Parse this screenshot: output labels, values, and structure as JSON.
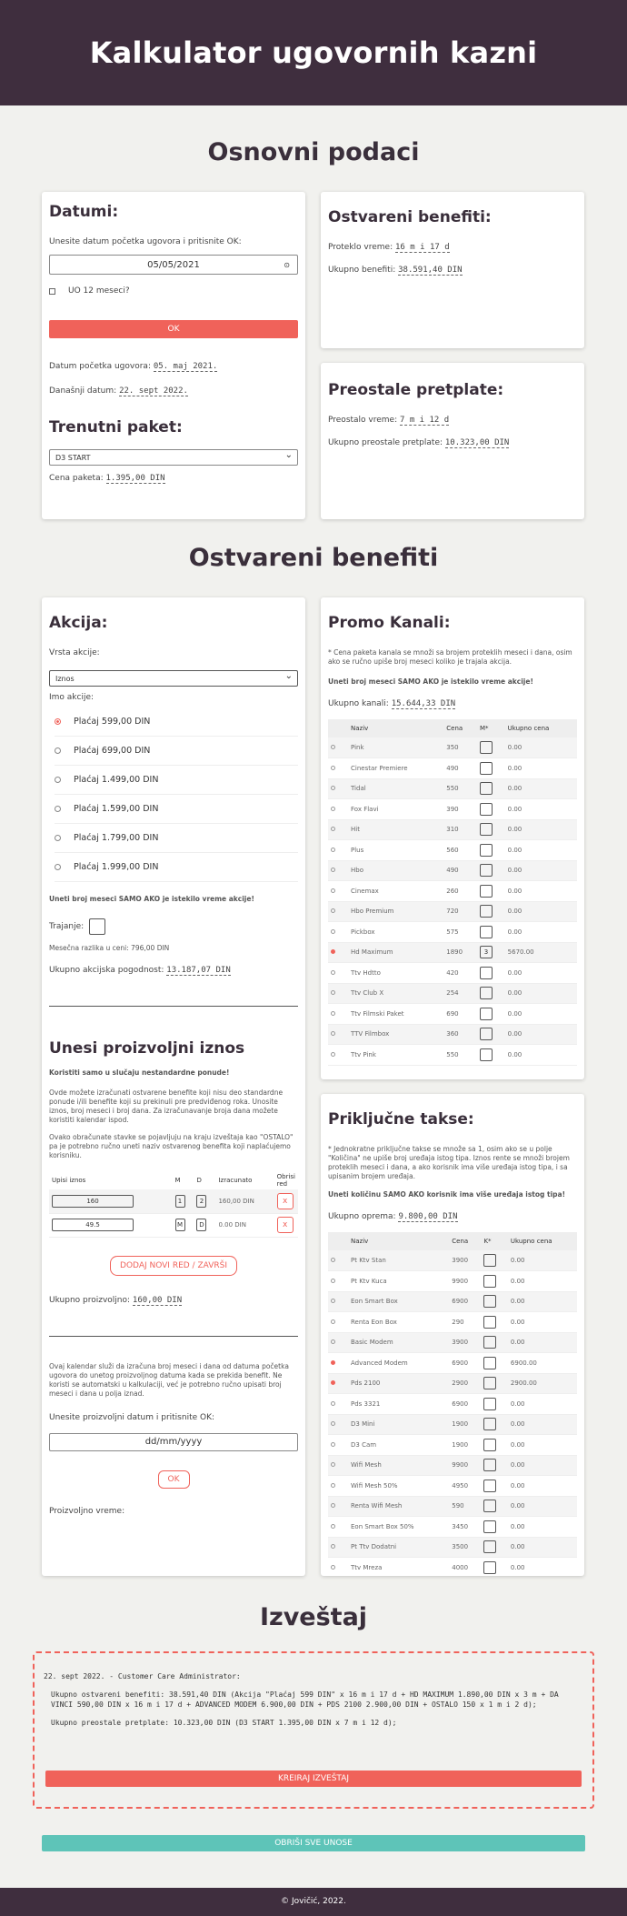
{
  "header": {
    "title": "Kalkulator ugovornih kazni"
  },
  "sections": {
    "basic": "Osnovni podaci",
    "benefits": "Ostvareni benefiti",
    "report": "Izveštaj"
  },
  "dates": {
    "title": "Datumi:",
    "prompt": "Unesite datum početka ugovora i pritisnite OK:",
    "date_value": "05/05/2021",
    "checkbox_label": "UO 12 meseci?",
    "ok": "OK",
    "start_label": "Datum početka ugovora:",
    "start_value": "05. maj 2021.",
    "today_label": "Današnji datum:",
    "today_value": "22. sept 2022."
  },
  "package": {
    "title": "Trenutni paket:",
    "selected": "D3 START",
    "price_label": "Cena paketa:",
    "price_value": "1.395,00 DIN"
  },
  "achieved": {
    "title": "Ostvareni benefiti:",
    "time_label": "Proteklo vreme:",
    "time_value": "16 m i 17 d",
    "total_label": "Ukupno benefiti:",
    "total_value": "38.591,40 DIN"
  },
  "remaining": {
    "title": "Preostale pretplate:",
    "time_label": "Preostalo vreme:",
    "time_value": "7 m i 12 d",
    "total_label": "Ukupno preostale pretplate:",
    "total_value": "10.323,00 DIN"
  },
  "action": {
    "title": "Akcija:",
    "type_label": "Vrsta akcije:",
    "type_selected": "Iznos",
    "amount_label": "Imo akcije:",
    "options": [
      "Plaćaj 599,00 DIN",
      "Plaćaj 699,00 DIN",
      "Plaćaj 1.499,00 DIN",
      "Plaćaj 1.599,00 DIN",
      "Plaćaj 1.799,00 DIN",
      "Plaćaj 1.999,00 DIN"
    ],
    "note": "Uneti broj meseci SAMO AKO je istekilo vreme akcije!",
    "duration_label": "Trajanje:",
    "diff": "Mesečna razlika u ceni: 796,00 DIN",
    "total_label": "Ukupno akcijska pogodnost:",
    "total_value": "13.187,07 DIN"
  },
  "custom": {
    "title": "Unesi proizvoljni iznos",
    "warn": "Koristiti samo u slučaju nestandardne ponude!",
    "p1": "Ovde možete izračunati ostvarene benefite koji nisu deo standardne ponude i/ili benefite koji su prekinuli pre predviđenog roka. Unosite iznos, broj meseci i broj dana. Za izračunavanje broja dana možete koristiti kalendar ispod.",
    "p2": "Ovako obračunate stavke se pojavljuju na kraju izveštaja kao \"OSTALO\" pa je potrebno ručno uneti naziv ostvarenog benefita koji naplaćujemo korisniku.",
    "col_amount": "Upisi iznos",
    "col_m": "M",
    "col_d": "D",
    "col_calc": "Izracunato",
    "col_del": "Obrisi red",
    "rows": [
      {
        "amount": "160",
        "m": "1",
        "d": "2",
        "calc": "160,00 DIN"
      },
      {
        "amount": "49.5",
        "m": "M",
        "d": "D",
        "calc": "0.00 DIN"
      }
    ],
    "del": "x",
    "add_btn": "DODAJ NOVI RED / ZAVRŠI",
    "total_label": "Ukupno proizvoljno:",
    "total_value": "160,00 DIN",
    "p3": "Ovaj kalendar služi da izračuna broj meseci i dana od datuma početka ugovora do unetog proizvoljnog datuma kada se prekida benefit. Ne koristi se automatski u kalkulaciji, već je potrebno ručno upisati broj meseci i dana u polja iznad.",
    "date_prompt": "Unesite proizvoljni datum i pritisnite OK:",
    "date_placeholder": "dd/mm/yyyy",
    "ok": "OK",
    "time_label": "Proizvoljno vreme:"
  },
  "promo": {
    "title": "Promo Kanali:",
    "note": "* Cena paketa kanala se množi sa brojem proteklih meseci i dana, osim ako se ručno upiše broj meseci koliko je trajala akcija.",
    "warn": "Uneti broj meseci SAMO AKO je istekilo vreme akcije!",
    "total_label": "Ukupno kanali:",
    "total_value": "15.644,33 DIN",
    "cols": [
      "Naziv",
      "Cena",
      "M*",
      "Ukupno cena"
    ],
    "rows": [
      {
        "n": "Pink",
        "c": "350",
        "m": "",
        "t": "0.00",
        "on": false
      },
      {
        "n": "Cinestar Premiere",
        "c": "490",
        "m": "",
        "t": "0.00",
        "on": false
      },
      {
        "n": "Tidal",
        "c": "550",
        "m": "",
        "t": "0.00",
        "on": false
      },
      {
        "n": "Fox Flavi",
        "c": "390",
        "m": "",
        "t": "0.00",
        "on": false
      },
      {
        "n": "Hit",
        "c": "310",
        "m": "",
        "t": "0.00",
        "on": false
      },
      {
        "n": "Plus",
        "c": "560",
        "m": "",
        "t": "0.00",
        "on": false
      },
      {
        "n": "Hbo",
        "c": "490",
        "m": "",
        "t": "0.00",
        "on": false
      },
      {
        "n": "Cinemax",
        "c": "260",
        "m": "",
        "t": "0.00",
        "on": false
      },
      {
        "n": "Hbo Premium",
        "c": "720",
        "m": "",
        "t": "0.00",
        "on": false
      },
      {
        "n": "Pickbox",
        "c": "575",
        "m": "",
        "t": "0.00",
        "on": false
      },
      {
        "n": "Hd Maximum",
        "c": "1890",
        "m": "3",
        "t": "5670.00",
        "on": true
      },
      {
        "n": "Ttv Hdtto",
        "c": "420",
        "m": "",
        "t": "0.00",
        "on": false
      },
      {
        "n": "Ttv Club X",
        "c": "254",
        "m": "",
        "t": "0.00",
        "on": false
      },
      {
        "n": "Ttv Filmski Paket",
        "c": "690",
        "m": "",
        "t": "0.00",
        "on": false
      },
      {
        "n": "TTV Filmbox",
        "c": "360",
        "m": "",
        "t": "0.00",
        "on": false
      },
      {
        "n": "Ttv Pink",
        "c": "550",
        "m": "",
        "t": "0.00",
        "on": false
      }
    ]
  },
  "fees": {
    "title": "Priključne takse:",
    "note": "* Jednokratne priključne takse se množe sa 1, osim ako se u polje \"Količina\" ne upiše broj uređaja istog tipa. Iznos rente se množi brojem proteklih meseci i dana, a ako korisnik ima više uređaja istog tipa, i sa upisanim brojem uređaja.",
    "warn": "Uneti količinu SAMO AKO korisnik ima više uređaja istog tipa!",
    "total_label": "Ukupno oprema:",
    "total_value": "9.800,00 DIN",
    "cols": [
      "Naziv",
      "Cena",
      "K*",
      "Ukupno cena"
    ],
    "rows": [
      {
        "n": "Pt Ktv Stan",
        "c": "3900",
        "t": "0.00",
        "on": false
      },
      {
        "n": "Pt Ktv Kuca",
        "c": "9900",
        "t": "0.00",
        "on": false
      },
      {
        "n": "Eon Smart Box",
        "c": "6900",
        "t": "0.00",
        "on": false
      },
      {
        "n": "Renta Eon Box",
        "c": "290",
        "t": "0.00",
        "on": false
      },
      {
        "n": "Basic Modem",
        "c": "3900",
        "t": "0.00",
        "on": false
      },
      {
        "n": "Advanced Modem",
        "c": "6900",
        "t": "6900.00",
        "on": true
      },
      {
        "n": "Pds 2100",
        "c": "2900",
        "t": "2900.00",
        "on": true
      },
      {
        "n": "Pds 3321",
        "c": "6900",
        "t": "0.00",
        "on": false
      },
      {
        "n": "D3 Mini",
        "c": "1900",
        "t": "0.00",
        "on": false
      },
      {
        "n": "D3 Cam",
        "c": "1900",
        "t": "0.00",
        "on": false
      },
      {
        "n": "Wifi Mesh",
        "c": "9900",
        "t": "0.00",
        "on": false
      },
      {
        "n": "Wifi Mesh 50%",
        "c": "4950",
        "t": "0.00",
        "on": false
      },
      {
        "n": "Renta Wifi Mesh",
        "c": "590",
        "t": "0.00",
        "on": false
      },
      {
        "n": "Eon Smart Box 50%",
        "c": "3450",
        "t": "0.00",
        "on": false
      },
      {
        "n": "Pt Ttv Dodatni",
        "c": "3500",
        "t": "0.00",
        "on": false
      },
      {
        "n": "Ttv Mreza",
        "c": "4000",
        "t": "0.00",
        "on": false
      }
    ]
  },
  "report": {
    "line1": "22. sept 2022. - Customer Care Administrator:",
    "line2": "Ukupno ostvareni benefiti: 38.591,40 DIN (Akcija \"Plaćaj 599 DIN\" x  16 m i 17 d + HD MAXIMUM 1.890,00 DIN x 3 m + DA VINCI 590,00 DIN x 16 m i 17 d + ADVANCED MODEM 6.900,00 DIN + PDS 2100 2.900,00 DIN + OSTALO 150 x 1 m i 2 d);",
    "line3": "Ukupno preostale pretplate: 10.323,00 DIN (D3 START 1.395,00 DIN x 7 m i 12 d);",
    "create": "KREIRAJ IZVEŠTAJ"
  },
  "clear": "OBRIŠI SVE UNOSE",
  "footer": "© Jovičić, 2022."
}
